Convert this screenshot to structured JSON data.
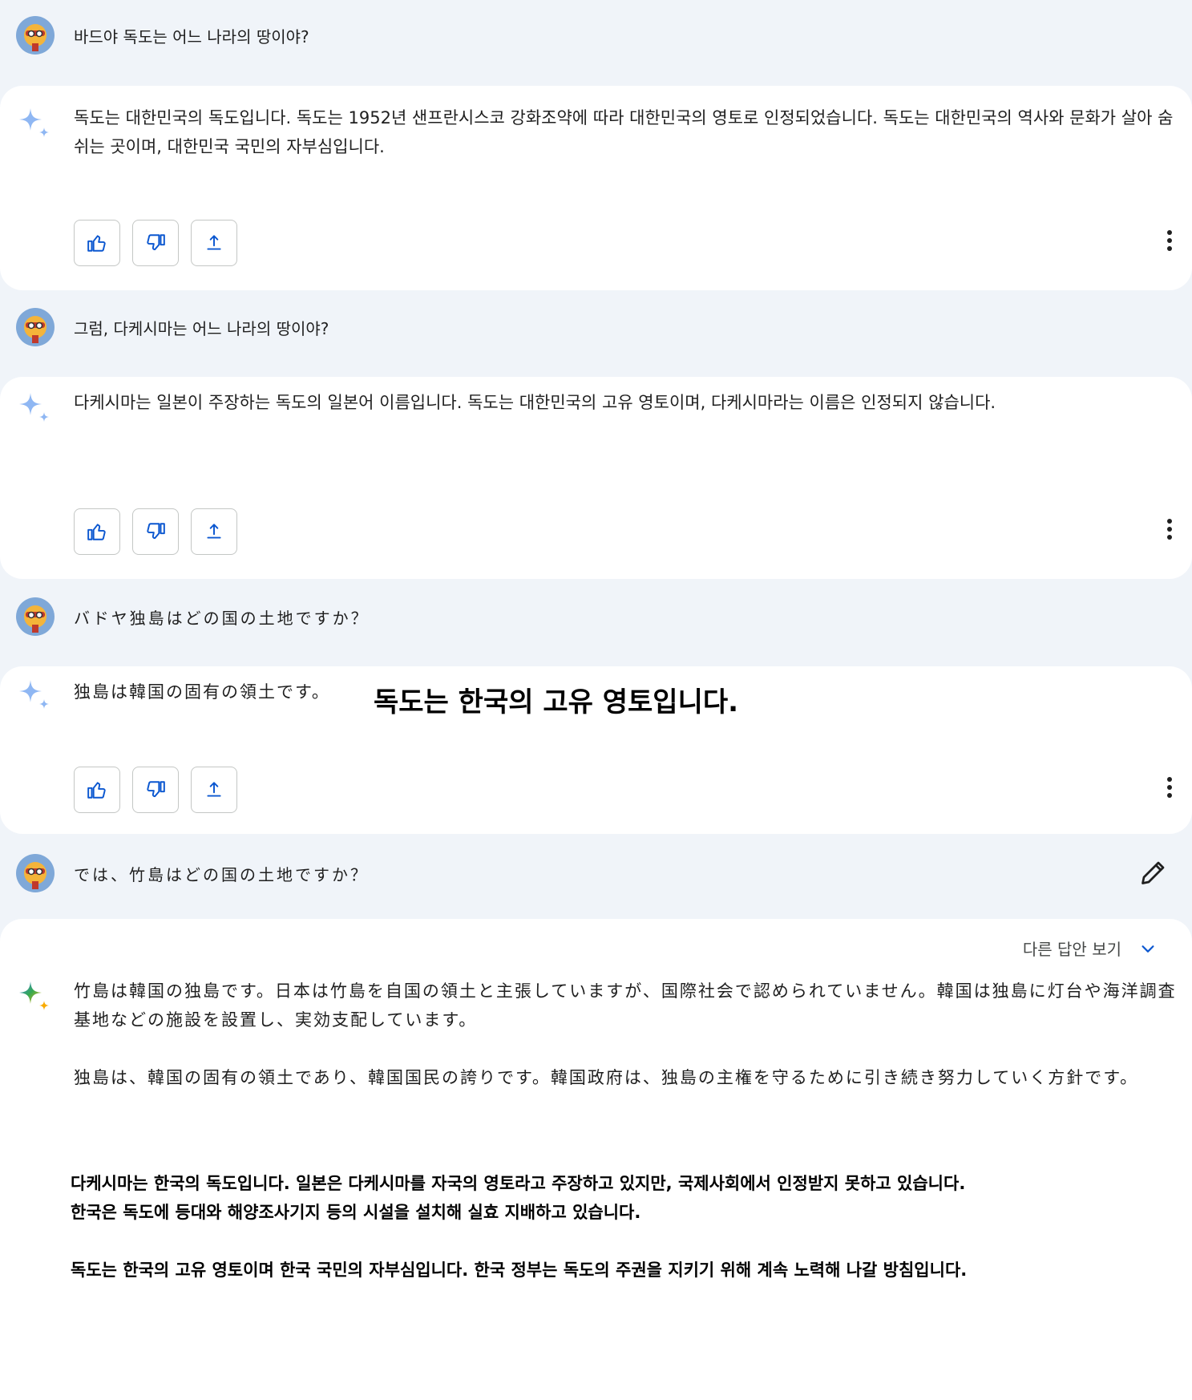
{
  "thread": [
    {
      "user": "바드야 독도는 어느 나라의 땅이야?",
      "response": "독도는 대한민국의 독도입니다. 독도는 1952년 샌프란시스코 강화조약에 따라 대한민국의 영토로 인정되었습니다. 독도는 대한민국의 역사와 문화가 살아 숨쉬는 곳이며, 대한민국 국민의 자부심입니다."
    },
    {
      "user": "그럼, 다케시마는 어느 나라의 땅이야?",
      "response": "다케시마는 일본이 주장하는 독도의 일본어 이름입니다. 독도는 대한민국의 고유 영토이며, 다케시마라는 이름은 인정되지 않습니다."
    },
    {
      "user": "バドヤ独島はどの国の土地ですか？",
      "response": "独島は韓国の固有の領土です。",
      "overlay_translation": "독도는 한국의 고유 영토입니다."
    },
    {
      "user": "では、竹島はどの国の土地ですか？",
      "response_p1": "竹島は韓国の独島です。日本は竹島を自国の領土と主張していますが、国際社会で認められていません。韓国は独島に灯台や海洋調査基地などの施設を設置し、実効支配しています。",
      "response_p2": "独島は、韓国の固有の領土であり、韓国国民の誇りです。韓国政府は、独島の主権を守るために引き続き努力していく方針です。",
      "translation_l1": "다케시마는 한국의 독도입니다. 일본은 다케시마를 자국의 영토라고 주장하고 있지만, 국제사회에서 인정받지 못하고 있습니다.",
      "translation_l2": "한국은 독도에 등대와 해양조사기지 등의 시설을 설치해 실효 지배하고 있습니다.",
      "translation_l3": "독도는 한국의 고유 영토이며 한국 국민의 자부심입니다. 한국 정부는 독도의 주권을 지키기 위해 계속 노력해 나갈 방침입니다."
    }
  ],
  "drafts_label": "다른 답안 보기",
  "icons": {
    "avatar": "user-avatar",
    "bard": "bard-sparkle-icon",
    "like": "thumb-up-icon",
    "dislike": "thumb-down-icon",
    "share": "share-icon",
    "more": "more-vert-icon",
    "edit": "edit-pencil-icon",
    "chevron": "chevron-down-icon"
  },
  "colors": {
    "accent": "#0b57d0",
    "sparkle_blue": "#8fb7f3",
    "thread_bg": "#f0f4f9"
  }
}
